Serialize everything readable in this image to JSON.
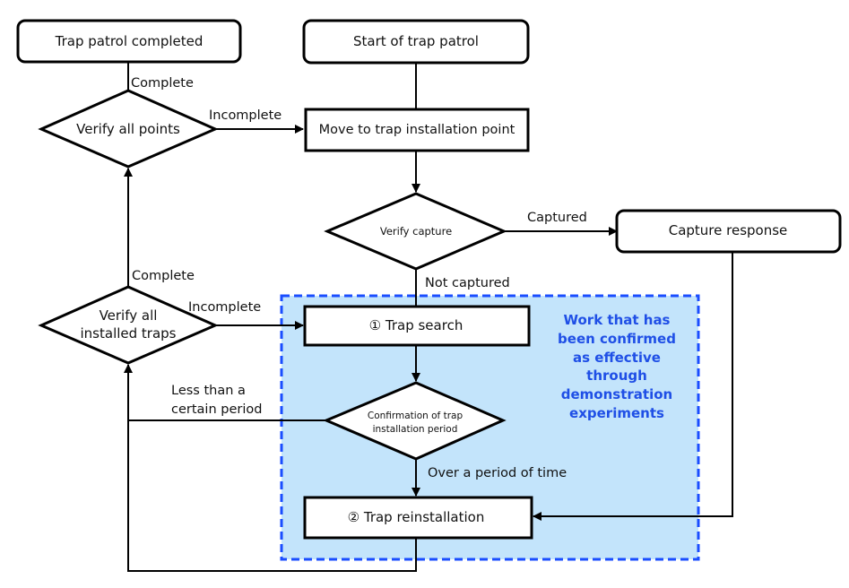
{
  "colors": {
    "line": "#000000",
    "region_fill": "#c3e4fb",
    "region_border": "#1a4dff",
    "note_text": "#1f4fe6"
  },
  "nodes": {
    "trap_patrol_completed": "Trap patrol completed",
    "start_of_trap_patrol": "Start of trap patrol",
    "verify_all_points": "Verify all points",
    "move_to_point": "Move to trap installation point",
    "verify_capture": "Verify capture",
    "capture_response": "Capture response",
    "verify_installed_traps": [
      "Verify all",
      "installed traps"
    ],
    "trap_search": "① Trap search",
    "confirm_period": [
      "Confirmation of trap",
      "installation period"
    ],
    "trap_reinstallation": "② Trap reinstallation"
  },
  "edge_labels": {
    "complete_top": "Complete",
    "incomplete_top": "Incomplete",
    "captured": "Captured",
    "not_captured": "Not captured",
    "complete_mid": "Complete",
    "incomplete_mid": "Incomplete",
    "less_than_period": [
      "Less than a",
      "certain period"
    ],
    "over_period": "Over a period of time"
  },
  "region_note": [
    "Work that has",
    "been confirmed",
    "as effective",
    "through",
    "demonstration",
    "experiments"
  ]
}
